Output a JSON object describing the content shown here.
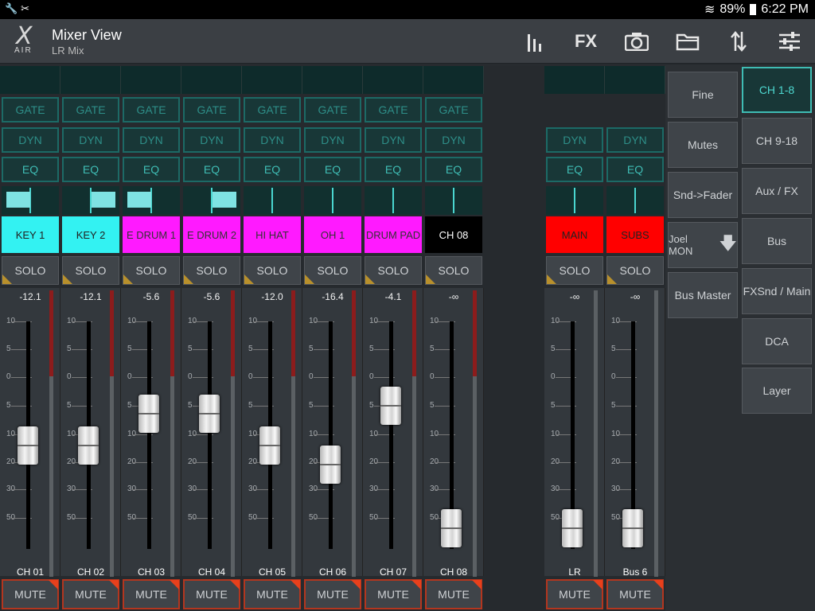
{
  "status": {
    "battery": "89%",
    "time": "6:22 PM"
  },
  "app": {
    "title": "Mixer View",
    "subtitle": "LR Mix",
    "logo_x": "X",
    "logo_air": "AIR",
    "fx_label": "FX"
  },
  "scale": [
    "10",
    "5",
    "0",
    "5",
    "10",
    "20",
    "30",
    "50"
  ],
  "channels": [
    {
      "name": "KEY 1",
      "value": "-12.1",
      "label": "CH 01",
      "color": "#33f2f2",
      "text": "#222",
      "gate": true,
      "fader": 17,
      "pan": {
        "side": "L",
        "w": 30
      }
    },
    {
      "name": "KEY 2",
      "value": "-12.1",
      "label": "CH 02",
      "color": "#33f2f2",
      "text": "#222",
      "gate": true,
      "fader": 17,
      "pan": {
        "side": "R",
        "w": 30
      }
    },
    {
      "name": "E DRUM 1",
      "value": "-5.6",
      "label": "CH 03",
      "color": "#ff1aff",
      "text": "#333",
      "gate": true,
      "fader": 32,
      "pan": {
        "side": "L",
        "w": 30
      }
    },
    {
      "name": "E DRUM 2",
      "value": "-5.6",
      "label": "CH 04",
      "color": "#ff1aff",
      "text": "#333",
      "gate": true,
      "fader": 32,
      "pan": {
        "side": "R",
        "w": 30
      }
    },
    {
      "name": "HI HAT",
      "value": "-12.0",
      "label": "CH 05",
      "color": "#ff1aff",
      "text": "#333",
      "gate": true,
      "fader": 17,
      "pan": {
        "side": "C",
        "w": 0
      }
    },
    {
      "name": "OH 1",
      "value": "-16.4",
      "label": "CH 06",
      "color": "#ff1aff",
      "text": "#333",
      "gate": true,
      "fader": 12,
      "pan": {
        "side": "C",
        "w": 0
      }
    },
    {
      "name": "DRUM PAD",
      "value": "-4.1",
      "label": "CH 07",
      "color": "#ff1aff",
      "text": "#333",
      "gate": true,
      "fader": 35,
      "pan": {
        "side": "C",
        "w": 0
      }
    },
    {
      "name": "CH 08",
      "value": "-∞",
      "label": "CH 08",
      "color": "#000000",
      "text": "#fff",
      "gate": true,
      "fader": 0,
      "pan": {
        "side": "C",
        "w": 0
      }
    }
  ],
  "buses": [
    {
      "name": "MAIN",
      "value": "-∞",
      "label": "LR",
      "color": "#ff0000",
      "text": "#222",
      "fader": 0
    },
    {
      "name": "SUBS",
      "value": "-∞",
      "label": "Bus 6",
      "color": "#ff0000",
      "text": "#222",
      "fader": 0
    }
  ],
  "labels": {
    "gate": "GATE",
    "dyn": "DYN",
    "eq": "EQ",
    "solo": "SOLO",
    "mute": "MUTE"
  },
  "sidebar": [
    "Fine",
    "Mutes",
    "Snd->Fader",
    "Joel MON",
    "Bus Master"
  ],
  "layers": [
    "CH 1-8",
    "CH 9-18",
    "Aux / FX",
    "Bus",
    "FXSnd / Main",
    "DCA",
    "Layer"
  ],
  "active_layer": "CH 1-8"
}
